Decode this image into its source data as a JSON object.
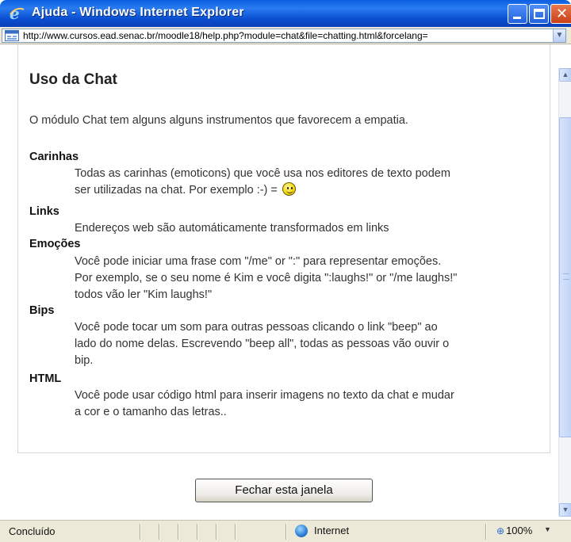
{
  "window": {
    "title": "Ajuda - Windows Internet Explorer",
    "icon": "ie-icon"
  },
  "address_bar": {
    "url": "http://www.cursos.ead.senac.br/moodle18/help.php?module=chat&file=chatting.html&forcelang="
  },
  "help": {
    "title": "Uso da Chat",
    "intro": "O módulo Chat tem alguns alguns instrumentos que favorecem a empatia.",
    "items": [
      {
        "term": "Carinhas",
        "desc_lines": [
          "Todas as carinhas (emoticons) que você usa nos editores de texto podem",
          "ser utilizadas na chat. Por exemplo :-) = "
        ],
        "icon": "smiley-icon"
      },
      {
        "term": "Links",
        "desc_lines": [
          "Endereços web são automáticamente transformados em links"
        ]
      },
      {
        "term": "Emoções",
        "desc_lines": [
          "Você pode iniciar uma frase com \"/me\" or \":\" para representar emoções.",
          "Por exemplo, se o seu nome é Kim e você digita \":laughs!\" or \"/me laughs!\"",
          "todos vão ler \"Kim laughs!\""
        ]
      },
      {
        "term": "Bips",
        "desc_lines": [
          "Você pode tocar um som para outras pessoas clicando o link \"beep\" ao",
          "lado do nome delas. Escrevendo \"beep all\", todas as pessoas vão ouvir o",
          "bip."
        ]
      },
      {
        "term": "HTML",
        "desc_lines": [
          "Você pode usar código html para inserir imagens no texto da chat e mudar",
          "a cor e o tamanho das letras.."
        ]
      }
    ],
    "close_button_label": "Fechar esta janela"
  },
  "status_bar": {
    "status": "Concluído",
    "zone": "Internet",
    "zoom": "100%"
  },
  "colors": {
    "titlebar": "#0a4fd0",
    "chrome": "#ece9d8"
  }
}
